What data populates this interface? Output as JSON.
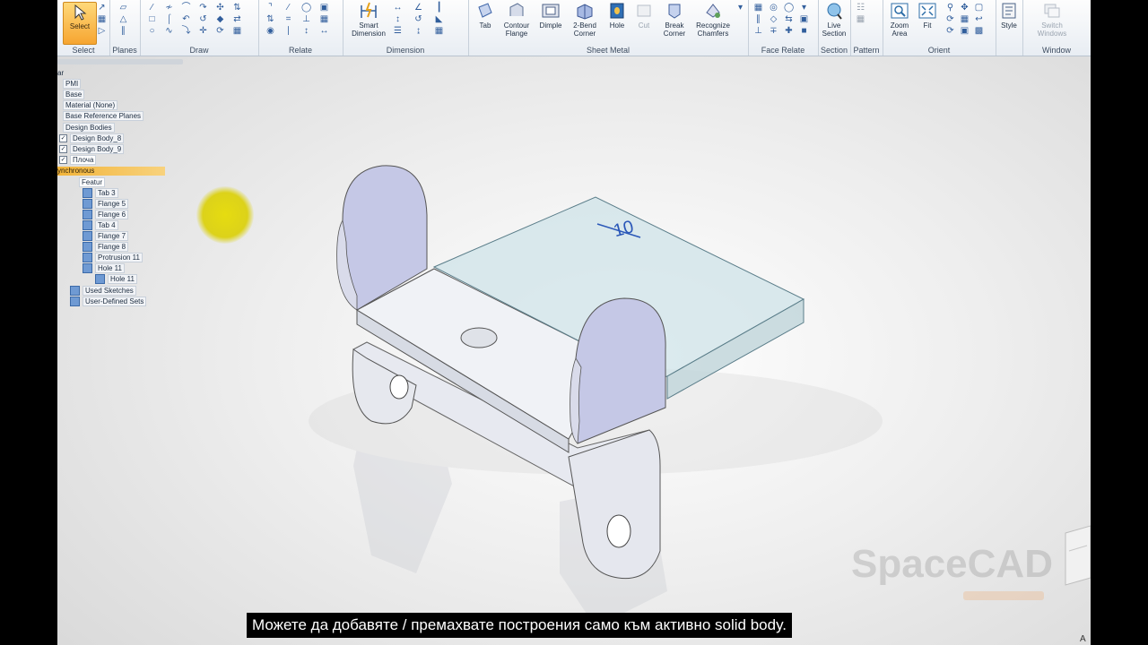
{
  "ribbon": {
    "groups": {
      "select": "Select",
      "planes": "Planes",
      "draw": "Draw",
      "relate": "Relate",
      "dimension": "Dimension",
      "sheet_metal": "Sheet Metal",
      "face_relate": "Face Relate",
      "section": "Section",
      "pattern": "Pattern",
      "orient": "Orient",
      "window": "Window"
    },
    "buttons": {
      "select": "Select",
      "smart_dimension_1": "Smart",
      "smart_dimension_2": "Dimension",
      "tab": "Tab",
      "contour_flange_1": "Contour",
      "contour_flange_2": "Flange",
      "dimple": "Dimple",
      "two_bend_corner_1": "2-Bend",
      "two_bend_corner_2": "Corner",
      "hole": "Hole",
      "cut": "Cut",
      "break_corner_1": "Break",
      "break_corner_2": "Corner",
      "recognize_chamfers_1": "Recognize",
      "recognize_chamfers_2": "Chamfers",
      "live_section_1": "Live",
      "live_section_2": "Section",
      "zoom_area_1": "Zoom",
      "zoom_area_2": "Area",
      "fit": "Fit",
      "style": "Style",
      "switch_windows_1": "Switch",
      "switch_windows_2": "Windows"
    }
  },
  "pathfinder": {
    "items": [
      {
        "label": "PMI"
      },
      {
        "label": "Base"
      },
      {
        "label": "Material (None)"
      },
      {
        "label": "Base Reference Planes"
      },
      {
        "label": "Design Bodies"
      },
      {
        "label": "Design Body_8"
      },
      {
        "label": "Design Body_9"
      },
      {
        "label": "Плоча"
      }
    ],
    "env_label": "ynchronous",
    "features_label": "Featur",
    "features": [
      {
        "label": "Tab 3"
      },
      {
        "label": "Flange 5"
      },
      {
        "label": "Flange 6"
      },
      {
        "label": "Tab 4"
      },
      {
        "label": "Flange 7"
      },
      {
        "label": "Flange 8"
      },
      {
        "label": "Protrusion 11"
      },
      {
        "label": "Hole 11"
      },
      {
        "label": "Hole 11"
      }
    ],
    "used_sketches": "Used Sketches",
    "user_defined_sets": "User-Defined Sets",
    "top_fragment": "ar"
  },
  "viewport": {
    "dimension_value": "10",
    "watermark": "SpaceCAD",
    "status_letter": "A"
  },
  "caption": "Можете да добавяте / премахвате построения само към активно solid body.",
  "colors": {
    "accent": "#f6a531",
    "plate": "#cfe3e8",
    "part": "#dfe3ec",
    "flange": "#c5c8e6"
  }
}
